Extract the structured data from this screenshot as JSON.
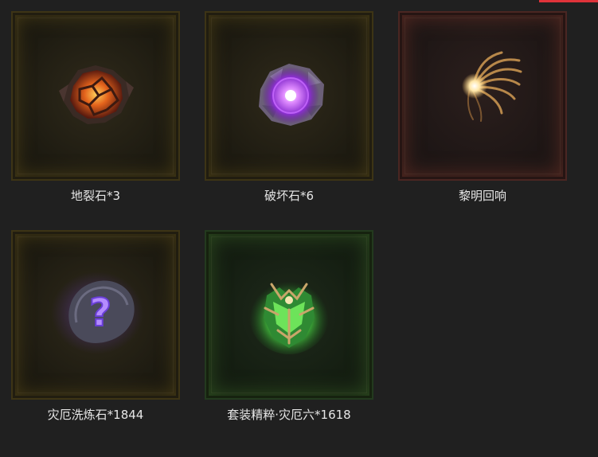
{
  "accent_color": "#e0333a",
  "items": [
    {
      "label": "地裂石*3",
      "icon": "earth-rift-stone-icon",
      "frame_color": "#3d3415"
    },
    {
      "label": "破坏石*6",
      "icon": "destruction-stone-icon",
      "frame_color": "#3d3415"
    },
    {
      "label": "黎明回响",
      "icon": "dawn-echo-icon",
      "frame_color": "#4a2622"
    },
    {
      "label": "灾厄洗炼石*1844",
      "icon": "calamity-refining-stone-icon",
      "frame_color": "#3d3415"
    },
    {
      "label": "套装精粹·灾厄六*1618",
      "icon": "set-essence-calamity-six-icon",
      "frame_color": "#233a1e"
    }
  ]
}
